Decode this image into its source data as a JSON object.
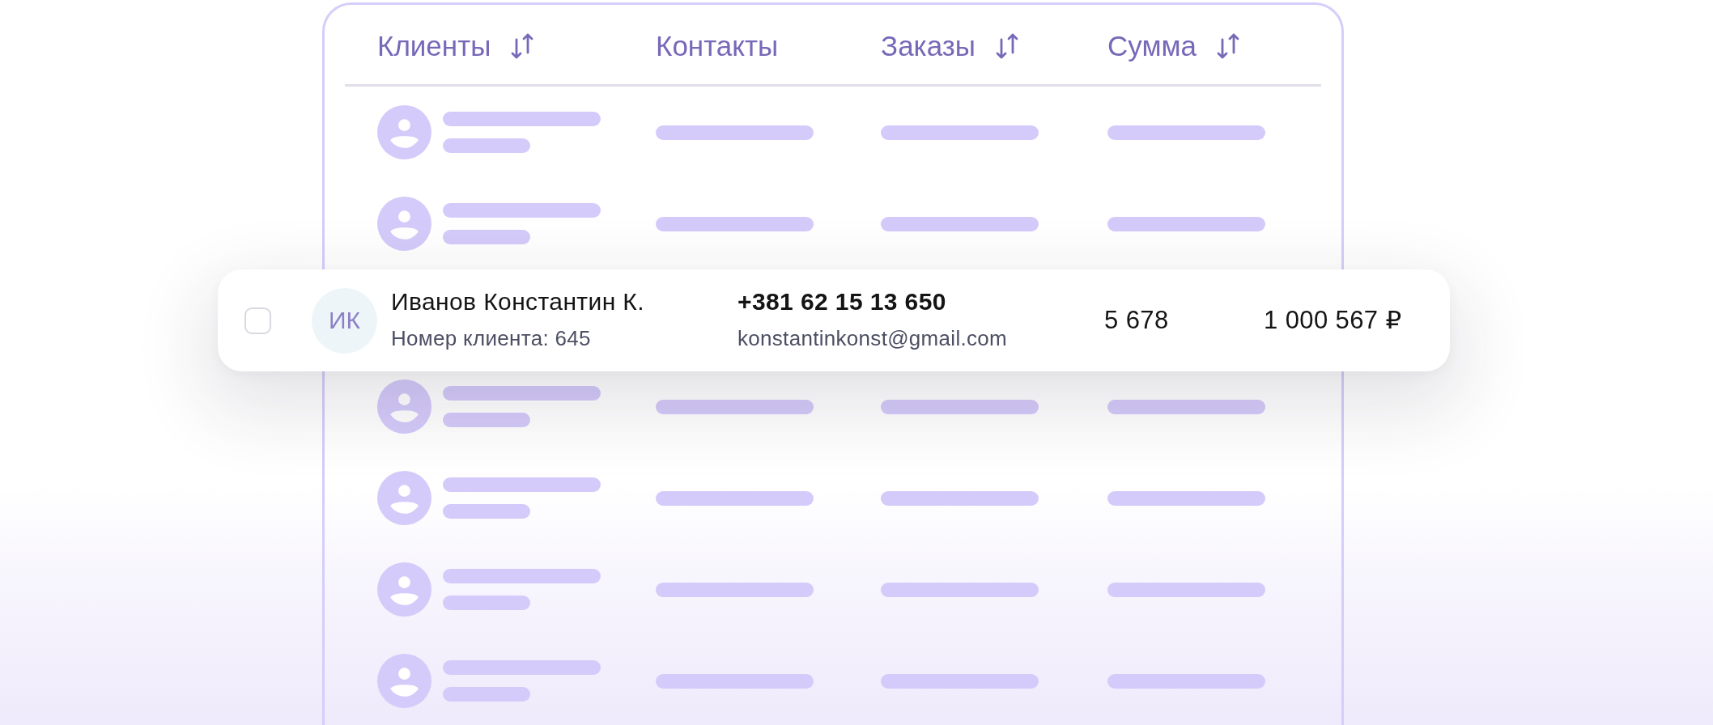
{
  "table": {
    "columns": [
      {
        "label": "Клиенты",
        "sortable": true
      },
      {
        "label": "Контакты",
        "sortable": false
      },
      {
        "label": "Заказы",
        "sortable": true
      },
      {
        "label": "Сумма",
        "sortable": true
      }
    ],
    "rows": [
      {
        "kind": "placeholder"
      },
      {
        "kind": "placeholder"
      },
      {
        "kind": "client",
        "checked": false,
        "initials": "ИК",
        "name": "Иванов Константин К.",
        "client_number": "Номер клиента: 645",
        "phone": "+381 62 15 13 650",
        "email": "konstantinkonst@gmail.com",
        "orders": "5 678",
        "total": "1 000 567 ₽"
      },
      {
        "kind": "placeholder"
      },
      {
        "kind": "placeholder"
      },
      {
        "kind": "placeholder"
      },
      {
        "kind": "placeholder"
      },
      {
        "kind": "placeholder"
      }
    ]
  }
}
